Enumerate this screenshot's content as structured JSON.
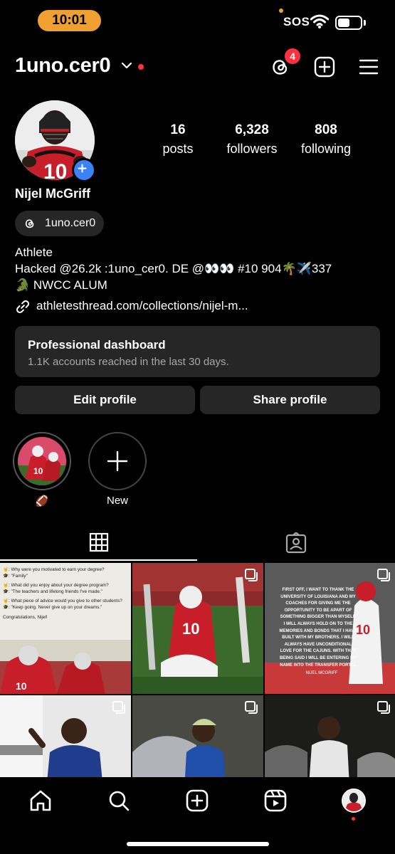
{
  "status_bar": {
    "time": "10:01",
    "carrier": "SOS"
  },
  "header": {
    "username": "1uno.cer0",
    "threads_badge": "4"
  },
  "profile": {
    "stats": [
      {
        "value": "16",
        "label": "posts"
      },
      {
        "value": "6,328",
        "label": "followers"
      },
      {
        "value": "808",
        "label": "following"
      }
    ],
    "full_name": "Nijel McGriff",
    "threads_handle": "1uno.cer0",
    "category": "Athlete",
    "bio_line_1": "Hacked @26.2k :1uno_cer0. DE @👀👀 #10 904🌴✈️337",
    "bio_line_2": "🐊 NWCC ALUM",
    "link": "athletesthread.com/collections/nijel-m..."
  },
  "dashboard": {
    "title": "Professional dashboard",
    "subtitle": "1.1K accounts reached in the last 30 days."
  },
  "buttons": {
    "edit": "Edit profile",
    "share": "Share profile"
  },
  "highlights": [
    {
      "label": "🏈"
    },
    {
      "label": "New"
    }
  ],
  "posts": {
    "post1_lines": [
      "🤘: Why were you motivated to earn your degree?",
      "🎓: \"Family\"",
      "🤘: What did you enjoy about your degree program?",
      "🎓: \"The teachers and lifelong friends I've made.\"",
      "🤘: What piece of advice would you give to other students?",
      "🎓: \"Keep going. Never give up on your dreams.\"",
      "Congratulations, Nijel!"
    ],
    "post3_text": "FIRST OFF, I WANT TO THANK THE UNIVERSITY OF LOUISIANA AND MY COACHES FOR GIVING ME THE OPPORTUNITY TO BE APART OF SOMETHING BIGGER THAN MYSELF. I WILL ALWAYS HOLD ON TO THE MEMORIES AND BONDS THAT I HAVE BUILT WITH MY BROTHERS. I WILL ALWAYS HAVE UNCONDITIONAL LOVE FOR THE CAJUNS. WITH THAT BEING SAID I WILL BE ENTERING MY NAME INTO THE TRANSFER PORTAL",
    "post3_sign": "NIJEL MCGRIFF"
  },
  "colors": {
    "accent_badge": "#ff3040",
    "add_avatar": "#3b82f6",
    "time_pill": "#f0a030"
  }
}
